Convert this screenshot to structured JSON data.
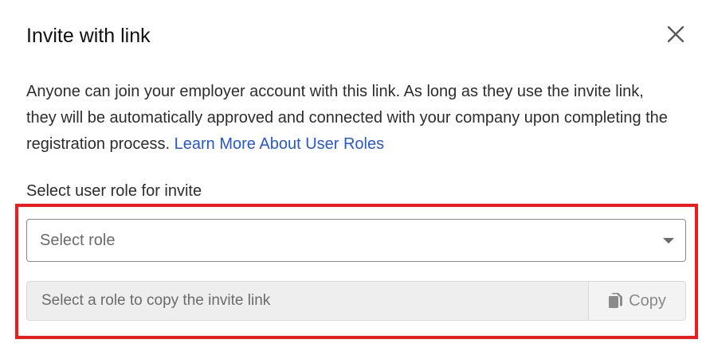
{
  "dialog": {
    "title": "Invite with link",
    "close_icon": "close-icon",
    "description": "Anyone can join your employer account with this link. As long as they use the invite link, they will be automatically approved and connected with your company upon completing the registration process.",
    "learn_more_link": "Learn More About User Roles"
  },
  "role_select": {
    "label": "Select user role for invite",
    "placeholder": "Select role",
    "icon": "chevron-down-icon"
  },
  "invite_link": {
    "placeholder": "Select a role to copy the invite link",
    "copy_label": "Copy",
    "copy_icon": "copy-icon"
  },
  "colors": {
    "link": "#2557d6",
    "highlight": "#ee1c1c",
    "disabled_bg": "#eeeeee"
  }
}
